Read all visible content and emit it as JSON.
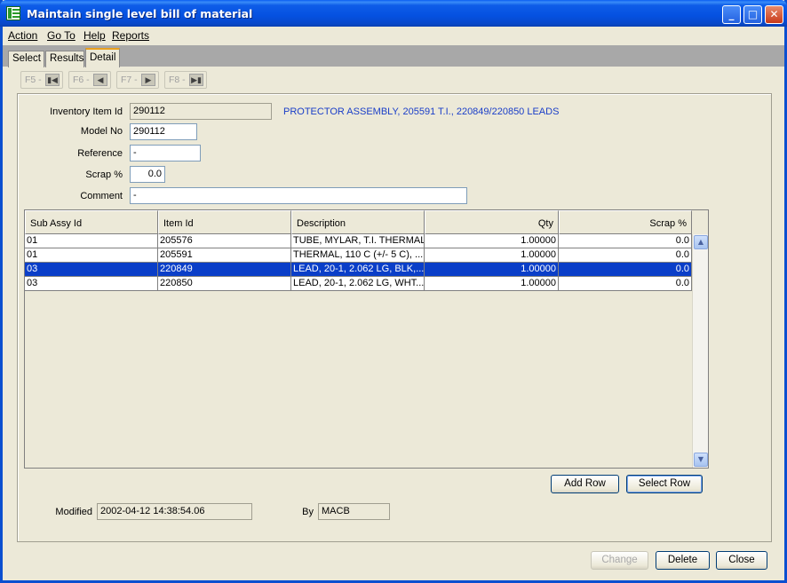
{
  "window": {
    "title": "Maintain single level bill of material"
  },
  "menu": [
    {
      "label": "Action"
    },
    {
      "label": "Go To"
    },
    {
      "label": "Help"
    },
    {
      "label": "Reports"
    }
  ],
  "tabs": [
    {
      "label": "Select"
    },
    {
      "label": "Results"
    },
    {
      "label": "Detail"
    }
  ],
  "nav": {
    "first": "F5 -",
    "prev": "F6 -",
    "next": "F7 -",
    "last": "F8 -"
  },
  "form": {
    "inventory_item_label": "Inventory Item Id",
    "inventory_item_value": "290112",
    "inventory_item_desc": "PROTECTOR ASSEMBLY, 205591 T.I., 220849/220850 LEADS",
    "model_no_label": "Model No",
    "model_no_value": "290112",
    "reference_label": "Reference",
    "reference_value": "-",
    "scrap_label": "Scrap %",
    "scrap_value": "0.0",
    "comment_label": "Comment",
    "comment_value": "-"
  },
  "grid": {
    "columns": [
      "Sub Assy Id",
      "Item Id",
      "Description",
      "Qty",
      "Scrap %"
    ],
    "rows": [
      {
        "sub_assy": "01",
        "item": "205576",
        "desc": "TUBE, MYLAR, T.I. THERMAL",
        "qty": "1.00000",
        "scrap": "0.0"
      },
      {
        "sub_assy": "01",
        "item": "205591",
        "desc": "THERMAL, 110 C (+/-  5 C), ...",
        "qty": "1.00000",
        "scrap": "0.0"
      },
      {
        "sub_assy": "03",
        "item": "220849",
        "desc": "LEAD, 20-1,  2.062 LG, BLK,...",
        "qty": "1.00000",
        "scrap": "0.0"
      },
      {
        "sub_assy": "03",
        "item": "220850",
        "desc": "LEAD, 20-1,  2.062 LG, WHT...",
        "qty": "1.00000",
        "scrap": "0.0"
      }
    ],
    "selected_row": 2
  },
  "grid_buttons": {
    "add_row": "Add Row",
    "select_row": "Select Row"
  },
  "audit": {
    "modified_label": "Modified",
    "modified_value": "2002-04-12 14:38:54.06",
    "by_label": "By",
    "by_value": "MACB"
  },
  "footer": {
    "change": "Change",
    "delete": "Delete",
    "close": "Close"
  },
  "colors": {
    "selection": "#0a3ec8",
    "description_link": "#1a3ec8",
    "titlebar": "#0551e0"
  }
}
